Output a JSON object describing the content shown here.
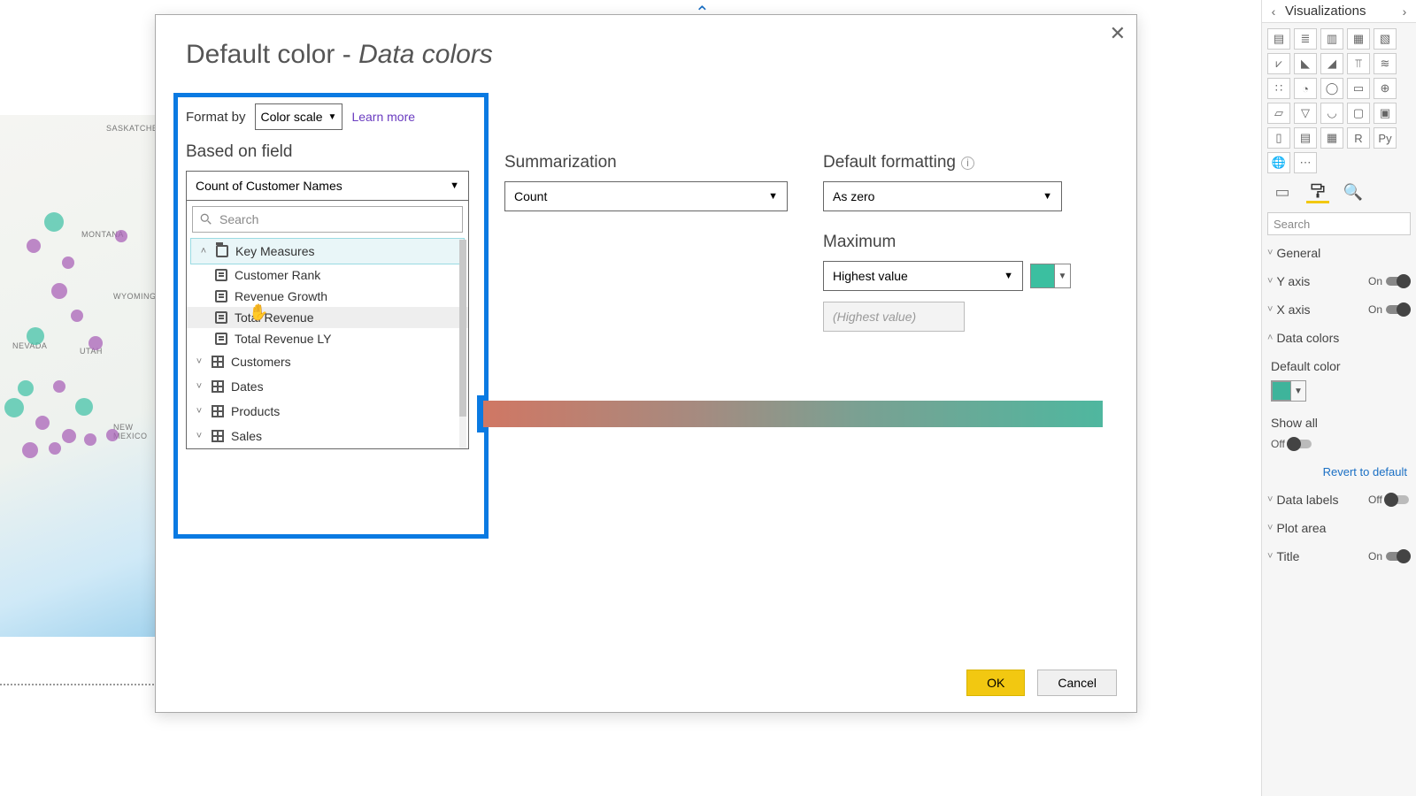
{
  "dialog": {
    "title_prefix": "Default color - ",
    "title_emph": "Data colors",
    "format_by_label": "Format by",
    "format_by_value": "Color scale",
    "learn_more": "Learn more",
    "based_on_field_label": "Based on field",
    "based_on_field_value": "Count of Customer Names",
    "summarization_label": "Summarization",
    "summarization_value": "Count",
    "default_formatting_label": "Default formatting",
    "default_formatting_value": "As zero",
    "maximum_label": "Maximum",
    "maximum_value": "Highest value",
    "maximum_placeholder": "(Highest value)",
    "maximum_color": "#3bbfa0",
    "ok": "OK",
    "cancel": "Cancel"
  },
  "picker": {
    "search_placeholder": "Search",
    "groups": [
      {
        "name": "Key Measures",
        "type": "folder",
        "expanded": true,
        "selected": true,
        "fields": [
          {
            "name": "Customer Rank"
          },
          {
            "name": "Revenue Growth"
          },
          {
            "name": "Total Revenue",
            "hover": true
          },
          {
            "name": "Total Revenue LY"
          }
        ]
      },
      {
        "name": "Customers",
        "type": "table",
        "expanded": false
      },
      {
        "name": "Dates",
        "type": "table",
        "expanded": false
      },
      {
        "name": "Products",
        "type": "table",
        "expanded": false
      },
      {
        "name": "Sales",
        "type": "table",
        "expanded": false
      }
    ]
  },
  "viz": {
    "title": "Visualizations",
    "search": "Search",
    "rows": [
      {
        "label": "General",
        "toggle": null
      },
      {
        "label": "Y axis",
        "toggle": "On"
      },
      {
        "label": "X axis",
        "toggle": "On"
      },
      {
        "label": "Data colors",
        "toggle": null
      },
      {
        "label": "Default color",
        "toggle": null,
        "swatch": "#3bbfa0"
      },
      {
        "label": "Show all",
        "toggle": "Off"
      },
      {
        "label": "Data labels",
        "toggle": "Off"
      },
      {
        "label": "Plot area",
        "toggle": null
      },
      {
        "label": "Title",
        "toggle": "On"
      }
    ],
    "revert": "Revert to default"
  },
  "map": {
    "states": [
      "SASKATCHEWAN",
      "MONTANA",
      "WYOMING",
      "NEVADA",
      "UTAH",
      "NEW MEXICO"
    ]
  }
}
